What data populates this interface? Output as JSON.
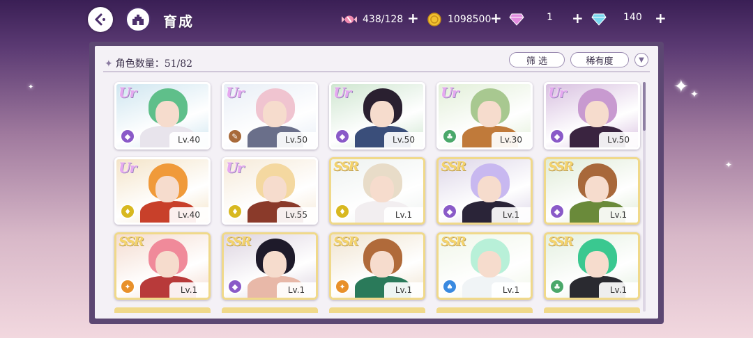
{
  "header": {
    "title": "育成",
    "resources": [
      {
        "name": "candy",
        "value": "438/128",
        "icon": "candy-icon"
      },
      {
        "name": "gold",
        "value": "1098500",
        "icon": "gold-coin-icon"
      },
      {
        "name": "pink_gem",
        "value": "1",
        "icon": "pink-diamond-icon"
      },
      {
        "name": "blue_gem",
        "value": "140",
        "icon": "blue-diamond-icon"
      }
    ]
  },
  "panel": {
    "count_label": "角色数量：51/82",
    "filter_label": "筛 选",
    "rarity_label": "稀有度"
  },
  "colors": {
    "ur": "#e6a8f0",
    "ssr": "#f4d36a",
    "panel_frame": "#5c4772"
  },
  "characters": [
    {
      "rarity": "UR",
      "level": "Lv.40",
      "attr": "purple",
      "hair": "#5fbf8a",
      "outfit": "#e8e4ec",
      "bg": "#cfe6f0"
    },
    {
      "rarity": "UR",
      "level": "Lv.50",
      "attr": "brown",
      "hair": "#f0c4d0",
      "outfit": "#6a6f8a",
      "bg": "#e8eef6"
    },
    {
      "rarity": "UR",
      "level": "Lv.50",
      "attr": "purple",
      "hair": "#2a2030",
      "outfit": "#3a4e7a",
      "bg": "#cfe6d0"
    },
    {
      "rarity": "UR",
      "level": "Lv.30",
      "attr": "green",
      "hair": "#a8c890",
      "outfit": "#c07a3a",
      "bg": "#e2efd8"
    },
    {
      "rarity": "UR",
      "level": "Lv.50",
      "attr": "purple",
      "hair": "#c89ad0",
      "outfit": "#3a2440",
      "bg": "#d8c0e0"
    },
    {
      "rarity": "UR",
      "level": "Lv.40",
      "attr": "yellow",
      "hair": "#f09a3a",
      "outfit": "#c8402a",
      "bg": "#f4e4c8"
    },
    {
      "rarity": "UR",
      "level": "Lv.55",
      "attr": "yellow",
      "hair": "#f4d8a0",
      "outfit": "#8a3a2a",
      "bg": "#f6ead8"
    },
    {
      "rarity": "SSR",
      "level": "Lv.1",
      "attr": "yellow",
      "hair": "#e8dcc8",
      "outfit": "#f2eef0",
      "bg": "#eef2f0"
    },
    {
      "rarity": "SSR",
      "level": "Lv.1",
      "attr": "purple",
      "hair": "#c8b8f0",
      "outfit": "#2a2438",
      "bg": "#ddd6e8"
    },
    {
      "rarity": "SSR",
      "level": "Lv.1",
      "attr": "purple",
      "hair": "#a8683a",
      "outfit": "#6a8a3a",
      "bg": "#e0ecd8"
    },
    {
      "rarity": "SSR",
      "level": "Lv.1",
      "attr": "orange",
      "hair": "#f08a9a",
      "outfit": "#b83a3a",
      "bg": "#f4dcd0"
    },
    {
      "rarity": "SSR",
      "level": "Lv.1",
      "attr": "purple",
      "hair": "#1e1a2a",
      "outfit": "#e8b8a8",
      "bg": "#ddd4e0"
    },
    {
      "rarity": "SSR",
      "level": "Lv.1",
      "attr": "orange",
      "hair": "#b06a3a",
      "outfit": "#2a7a5a",
      "bg": "#f0e4d0"
    },
    {
      "rarity": "SSR",
      "level": "Lv.1",
      "attr": "blue",
      "hair": "#b8f0d8",
      "outfit": "#f0f4f6",
      "bg": "#f0f6e8"
    },
    {
      "rarity": "SSR",
      "level": "Lv.1",
      "attr": "green",
      "hair": "#3ac890",
      "outfit": "#2a2a30",
      "bg": "#e4f0e0"
    }
  ]
}
